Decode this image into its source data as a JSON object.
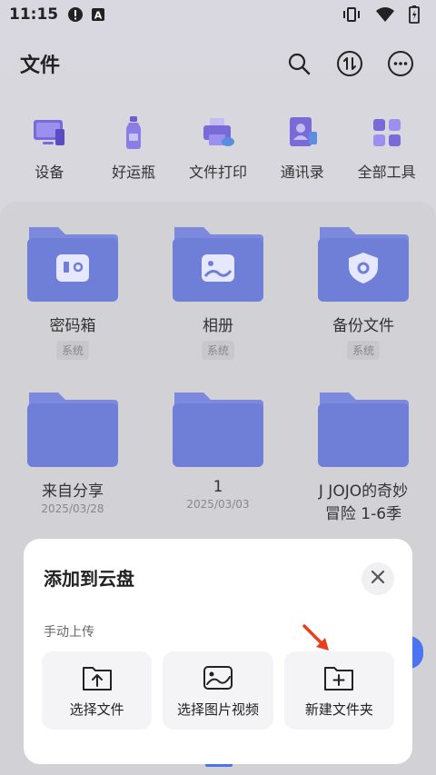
{
  "status_bar": {
    "time": "11:15",
    "icons": [
      "alert-icon",
      "a-icon",
      "vibrate-icon",
      "wifi-icon",
      "battery-icon"
    ]
  },
  "header": {
    "title": "文件",
    "actions": [
      "search-icon",
      "transfer-icon",
      "more-icon"
    ]
  },
  "tools": [
    {
      "label": "设备",
      "icon": "device-icon"
    },
    {
      "label": "好运瓶",
      "icon": "bottle-icon"
    },
    {
      "label": "文件打印",
      "icon": "printer-icon"
    },
    {
      "label": "通讯录",
      "icon": "contacts-icon"
    },
    {
      "label": "全部工具",
      "icon": "all-tools-icon"
    }
  ],
  "folders": [
    {
      "name": "密码箱",
      "tag": "系统",
      "icon": "safe-icon"
    },
    {
      "name": "相册",
      "tag": "系统",
      "icon": "photo-icon"
    },
    {
      "name": "备份文件",
      "tag": "系统",
      "icon": "shield-icon"
    },
    {
      "name": "来自分享",
      "date": "2025/03/28"
    },
    {
      "name": "1",
      "date": "2025/03/03"
    },
    {
      "name": "J JOJO的奇妙",
      "date": "冒险 1-6季"
    }
  ],
  "sheet": {
    "title": "添加到云盘",
    "section": "手动上传",
    "options": [
      {
        "label": "选择文件",
        "icon": "upload-file-icon"
      },
      {
        "label": "选择图片视频",
        "icon": "image-icon"
      },
      {
        "label": "新建文件夹",
        "icon": "new-folder-icon"
      }
    ]
  },
  "colors": {
    "accent": "#4b74f0",
    "folder": "#6f7fd8",
    "annotation": "#e8401c"
  }
}
